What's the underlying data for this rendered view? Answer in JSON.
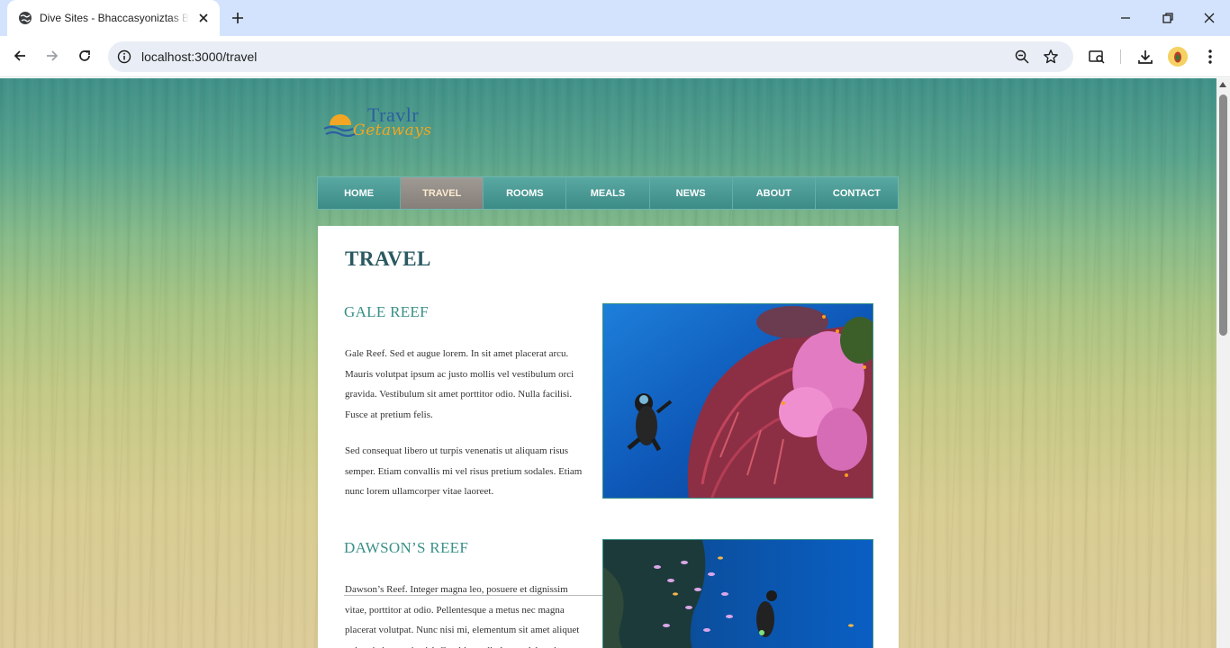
{
  "browser": {
    "tab_title": "Dive Sites - Bhaccasyoniztas Beach Resort",
    "url": "localhost:3000/travel"
  },
  "site": {
    "brand": "Travlr",
    "tagline": "Getaways",
    "nav": [
      {
        "label": "HOME",
        "active": false
      },
      {
        "label": "TRAVEL",
        "active": true
      },
      {
        "label": "ROOMS",
        "active": false
      },
      {
        "label": "MEALS",
        "active": false
      },
      {
        "label": "NEWS",
        "active": false
      },
      {
        "label": "ABOUT",
        "active": false
      },
      {
        "label": "CONTACT",
        "active": false
      }
    ]
  },
  "page": {
    "title": "TRAVEL",
    "sections": [
      {
        "heading": "GALE REEF",
        "paragraphs": [
          "Gale Reef. Sed et augue lorem. In sit amet placerat arcu. Mauris volutpat ipsum ac justo mollis vel vestibulum orci gravida. Vestibulum sit amet porttitor odio. Nulla facilisi. Fusce at pretium felis.",
          "Sed consequat libero ut turpis venenatis ut aliquam risus semper. Etiam convallis mi vel risus pretium sodales. Etiam nunc lorem ullamcorper vitae laoreet."
        ]
      },
      {
        "heading": "DAWSON’S REEF",
        "paragraphs": [
          "Dawson’s Reef. Integer magna leo, posuere et dignissim vitae, porttitor at odio. Pellentesque a metus nec magna placerat volutpat. Nunc nisi mi, elementum sit amet aliquet quis, tristique quis nisl. Curabitur odio leo, sodales vitae."
        ]
      }
    ]
  },
  "colors": {
    "nav_teal": "#3b8b87",
    "nav_active": "#857e79",
    "heading_teal": "#3a9088",
    "title_dark": "#2b5961"
  }
}
